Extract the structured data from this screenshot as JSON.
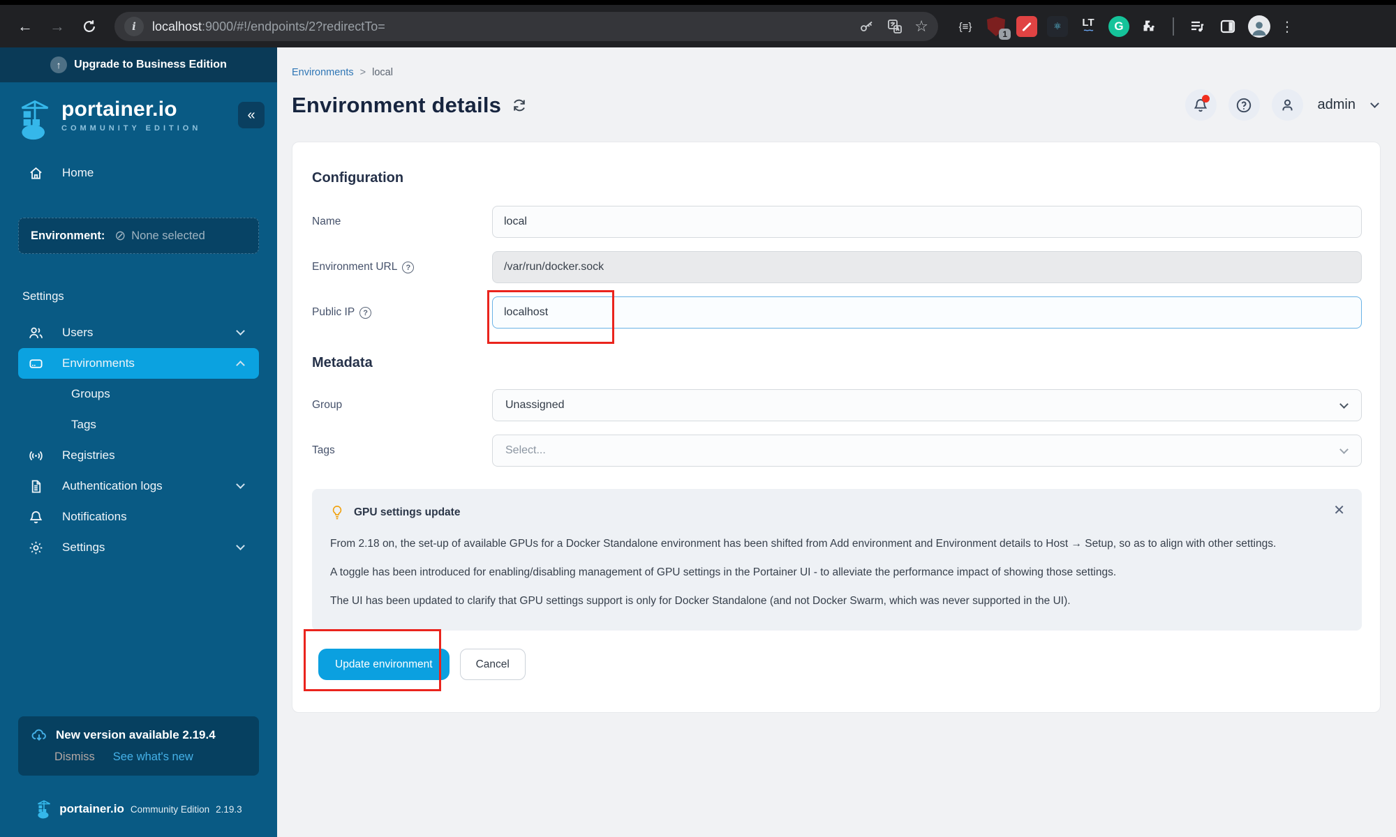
{
  "browser": {
    "url_host": "localhost",
    "url_rest": ":9000/#!/endpoints/2?redirectTo=",
    "extension_badge": "1",
    "glyphs": {
      "back": "←",
      "forward": "→",
      "info": "i",
      "star": "☆",
      "braces": "{≡}",
      "react": "⚛",
      "lt": "LT",
      "lt_wave": "~~",
      "grammarly": "G",
      "kebab": "⋮"
    }
  },
  "sidebar": {
    "upgrade_banner": "Upgrade to Business Edition",
    "upgrade_glyph": "↑",
    "collapse_glyph": "«",
    "logo_title": "portainer.io",
    "logo_subtitle": "COMMUNITY EDITION",
    "home_label": "Home",
    "environment_label": "Environment:",
    "environment_none_glyph": "⊘",
    "environment_value": "None selected",
    "section_settings": "Settings",
    "items": [
      {
        "label": "Users"
      },
      {
        "label": "Environments"
      },
      {
        "label": "Groups"
      },
      {
        "label": "Tags"
      },
      {
        "label": "Registries"
      },
      {
        "label": "Authentication logs"
      },
      {
        "label": "Notifications"
      },
      {
        "label": "Settings"
      }
    ],
    "version_banner": {
      "title": "New version available 2.19.4",
      "dismiss": "Dismiss",
      "see_whats_new": "See what's new"
    },
    "footer": {
      "brand": "portainer.io",
      "edition": "Community Edition",
      "version": "2.19.3"
    }
  },
  "header": {
    "breadcrumb_root": "Environments",
    "breadcrumb_sep": ">",
    "breadcrumb_current": "local",
    "title": "Environment details",
    "user": "admin",
    "help_glyph": "?"
  },
  "form": {
    "section_configuration": "Configuration",
    "name_label": "Name",
    "name_value": "local",
    "url_label": "Environment URL",
    "url_value": "/var/run/docker.sock",
    "public_ip_label": "Public IP",
    "public_ip_value": "localhost",
    "section_metadata": "Metadata",
    "group_label": "Group",
    "group_value": "Unassigned",
    "tags_label": "Tags",
    "tags_placeholder": "Select...",
    "gpu_note": {
      "title": "GPU settings update",
      "close_glyph": "✕",
      "p1": "From 2.18 on, the set-up of available GPUs for a Docker Standalone environment has been shifted from Add environment and Environment details to Host → Setup, so as to align with other settings.",
      "p2": "A toggle has been introduced for enabling/disabling management of GPU settings in the Portainer UI - to alleviate the performance impact of showing those settings.",
      "p3": "The UI has been updated to clarify that GPU settings support is only for Docker Standalone (and not Docker Swarm, which was never supported in the UI)."
    },
    "update_button": "Update environment",
    "cancel_button": "Cancel"
  },
  "colors": {
    "sidebar_bg": "#095a84",
    "active_item": "#0ba2e0",
    "primary_button": "#0ba0e0",
    "annotation_red": "#ea241d",
    "brand_blue": "#35b7ea",
    "notification_red": "#f02e1e"
  }
}
